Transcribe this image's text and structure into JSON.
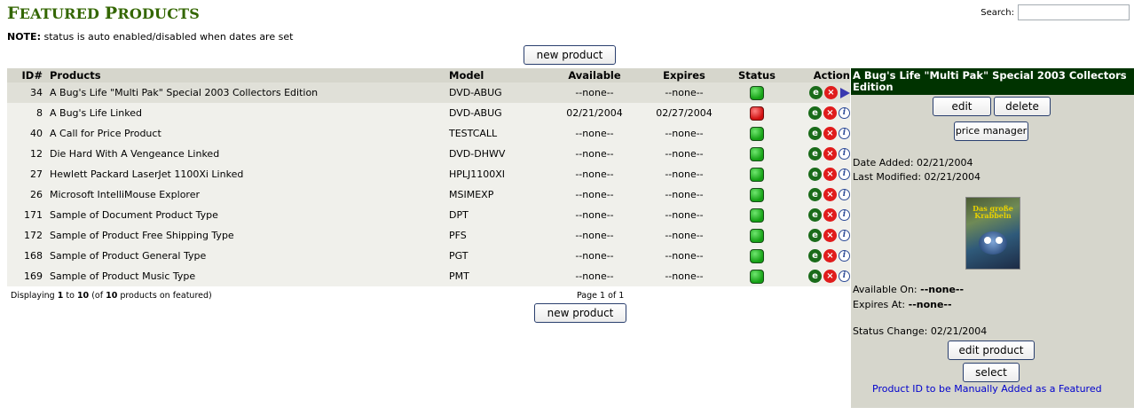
{
  "header": {
    "title_first_letter": "F",
    "title_rest1": "EATURED ",
    "title_second_letter": "P",
    "title_rest2": "RODUCTS",
    "search_label": "Search:",
    "search_value": ""
  },
  "note": {
    "label": "NOTE:",
    "text": " status is auto enabled/disabled when dates are set"
  },
  "buttons": {
    "new_product_top": "new product",
    "new_product_bottom": "new product"
  },
  "table": {
    "columns": [
      "ID#",
      "Products",
      "Model",
      "Available",
      "Expires",
      "Status",
      "Action"
    ],
    "rows": [
      {
        "id": "34",
        "name": "A Bug's Life \"Multi Pak\" Special 2003 Collectors Edition",
        "model": "DVD-ABUG",
        "available": "--none--",
        "expires": "--none--",
        "status": "on",
        "selected": true
      },
      {
        "id": "8",
        "name": "A Bug's Life Linked",
        "model": "DVD-ABUG",
        "available": "02/21/2004",
        "expires": "02/27/2004",
        "status": "off",
        "selected": false
      },
      {
        "id": "40",
        "name": "A Call for Price Product",
        "model": "TESTCALL",
        "available": "--none--",
        "expires": "--none--",
        "status": "on",
        "selected": false
      },
      {
        "id": "12",
        "name": "Die Hard With A Vengeance Linked",
        "model": "DVD-DHWV",
        "available": "--none--",
        "expires": "--none--",
        "status": "on",
        "selected": false
      },
      {
        "id": "27",
        "name": "Hewlett Packard LaserJet 1100Xi Linked",
        "model": "HPLJ1100XI",
        "available": "--none--",
        "expires": "--none--",
        "status": "on",
        "selected": false
      },
      {
        "id": "26",
        "name": "Microsoft IntelliMouse Explorer",
        "model": "MSIMEXP",
        "available": "--none--",
        "expires": "--none--",
        "status": "on",
        "selected": false
      },
      {
        "id": "171",
        "name": "Sample of Document Product Type",
        "model": "DPT",
        "available": "--none--",
        "expires": "--none--",
        "status": "on",
        "selected": false
      },
      {
        "id": "172",
        "name": "Sample of Product Free Shipping Type",
        "model": "PFS",
        "available": "--none--",
        "expires": "--none--",
        "status": "on",
        "selected": false
      },
      {
        "id": "168",
        "name": "Sample of Product General Type",
        "model": "PGT",
        "available": "--none--",
        "expires": "--none--",
        "status": "on",
        "selected": false
      },
      {
        "id": "169",
        "name": "Sample of Product Music Type",
        "model": "PMT",
        "available": "--none--",
        "expires": "--none--",
        "status": "on",
        "selected": false
      }
    ],
    "icons": {
      "edit": "e",
      "delete": "×",
      "info": "i"
    }
  },
  "footer": {
    "displaying_prefix": "Displaying ",
    "from": "1",
    "to_word": " to ",
    "to": "10",
    "of_prefix": " (of ",
    "total": "10",
    "of_suffix": " products on featured)",
    "page_text": "Page 1 of 1"
  },
  "side": {
    "title": "A Bug's Life \"Multi Pak\" Special 2003 Collectors Edition",
    "edit_label": "edit",
    "delete_label": "delete",
    "price_manager_label": "price manager",
    "date_added": "Date Added: 02/21/2004",
    "last_modified": "Last Modified: 02/21/2004",
    "image_text": "Das große Krabbeln",
    "available_on_label": "Available On: ",
    "available_on_value": "--none--",
    "expires_at_label": "Expires At: ",
    "expires_at_value": "--none--",
    "status_change": "Status Change: 02/21/2004",
    "edit_product_label": "edit product",
    "select_label": "select",
    "manual_link": "Product ID to be Manually Added as a Featured"
  },
  "colors": {
    "title_green": "#336600",
    "header_bg": "#d6d6cc",
    "side_title_bg": "#003300",
    "status_on": "#14a014",
    "status_off": "#d01010",
    "link_blue": "#0000cc"
  }
}
